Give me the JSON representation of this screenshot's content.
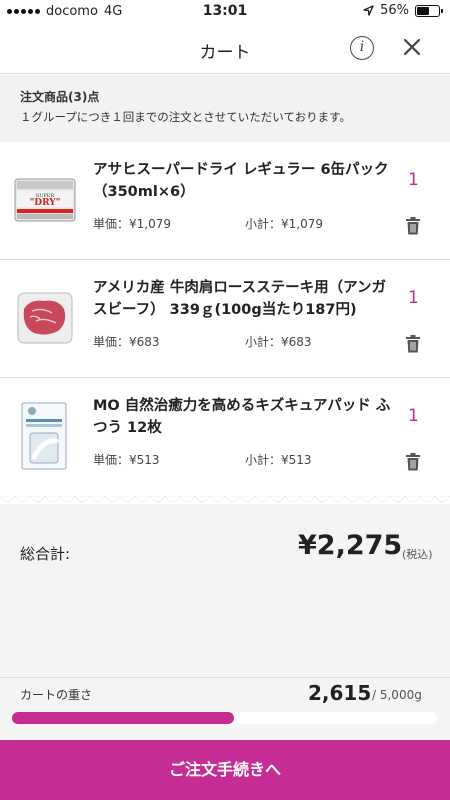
{
  "status_bar": {
    "carrier": "docomo",
    "network": "4G",
    "time": "13:01",
    "battery_percent": "56%",
    "battery_level": 0.56
  },
  "header": {
    "title": "カート",
    "info_icon": "info-icon",
    "close_icon": "close-icon"
  },
  "notice": {
    "title": "注文商品(3)点",
    "text": "１グループにつき１回までの注文とさせていただいております。"
  },
  "items": [
    {
      "name": "アサヒスーパードライ レギュラー 6缶パック （350ml×6）",
      "unit_price": "単価：¥1,079",
      "subtotal": "小計：¥1,079",
      "quantity": "1"
    },
    {
      "name": "アメリカ産 牛肉肩ロースステーキ用（アンガスビーフ） 339ｇ(100g当たり187円)",
      "unit_price": "単価：¥683",
      "subtotal": "小計：¥683",
      "quantity": "1"
    },
    {
      "name": "MO 自然治癒力を高めるキズキュアパッド ふつう 12枚",
      "unit_price": "単価：¥513",
      "subtotal": "小計：¥513",
      "quantity": "1"
    }
  ],
  "totals": {
    "label": "総合計:",
    "amount": "¥2,275",
    "tax_note": "(税込)"
  },
  "weight": {
    "label": "カートの重さ",
    "value": "2,615",
    "max": "/ 5,000g",
    "fraction": 0.523
  },
  "checkout": {
    "label": "ご注文手続きへ"
  },
  "colors": {
    "accent": "#c52d94",
    "quantity": "#b5308c"
  }
}
